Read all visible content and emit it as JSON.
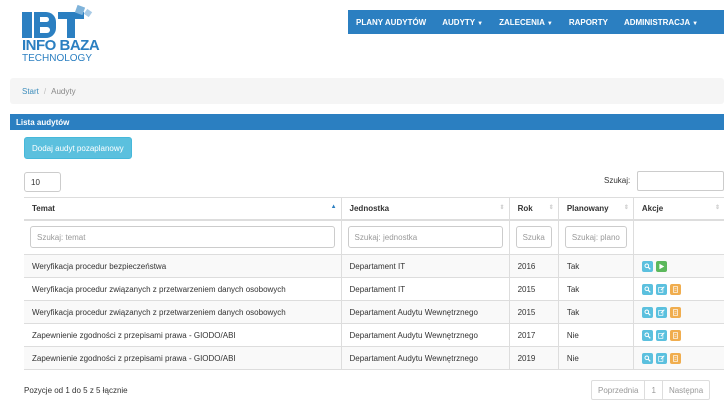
{
  "brand": {
    "line1": "INFO BAZA",
    "line2": "TECHNOLOGY"
  },
  "nav": [
    {
      "label": "PLANY AUDYTÓW",
      "dropdown": false
    },
    {
      "label": "AUDYTY",
      "dropdown": true
    },
    {
      "label": "ZALECENIA",
      "dropdown": true
    },
    {
      "label": "RAPORTY",
      "dropdown": false
    },
    {
      "label": "ADMINISTRACJA",
      "dropdown": true
    }
  ],
  "breadcrumb": {
    "home": "Start",
    "separator": "/",
    "current": "Audyty"
  },
  "panel": {
    "title": "Lista audytów",
    "add_button": "Dodaj audyt pozaplanowy"
  },
  "table_controls": {
    "page_length": "10",
    "search_label": "Szukaj:",
    "search_value": ""
  },
  "columns": [
    "Temat",
    "Jednostka",
    "Rok",
    "Planowany",
    "Akcje"
  ],
  "filters": {
    "temat": "Szukaj: temat",
    "jednostka": "Szukaj: jednostka",
    "rok": "Szuka",
    "planowany": "Szukaj: plano"
  },
  "rows": [
    {
      "temat": "Weryfikacja procedur bezpieczeństwa",
      "jednostka": "Departament IT",
      "rok": "2016",
      "planowany": "Tak",
      "actions": [
        "view-icon",
        "play-icon"
      ]
    },
    {
      "temat": "Weryfikacja procedur związanych z przetwarzeniem danych osobowych",
      "jednostka": "Departament IT",
      "rok": "2015",
      "planowany": "Tak",
      "actions": [
        "view-icon",
        "edit-icon",
        "document-icon"
      ]
    },
    {
      "temat": "Weryfikacja procedur związanych z przetwarzeniem danych osobowych",
      "jednostka": "Departament Audytu Wewnętrznego",
      "rok": "2015",
      "planowany": "Tak",
      "actions": [
        "view-icon",
        "edit-icon",
        "document-icon"
      ]
    },
    {
      "temat": "Zapewnienie zgodności z przepisami prawa - GIODO/ABI",
      "jednostka": "Departament Audytu Wewnętrznego",
      "rok": "2017",
      "planowany": "Nie",
      "actions": [
        "view-icon",
        "edit-icon",
        "document-icon"
      ]
    },
    {
      "temat": "Zapewnienie zgodności z przepisami prawa - GIODO/ABI",
      "jednostka": "Departament Audytu Wewnętrznego",
      "rok": "2019",
      "planowany": "Nie",
      "actions": [
        "view-icon",
        "edit-icon",
        "document-icon"
      ]
    }
  ],
  "footer": {
    "info": "Pozycje od 1 do 5 z 5 łącznie",
    "prev": "Poprzednia",
    "page": "1",
    "next": "Następna"
  },
  "colors": {
    "primary": "#2b7fc1",
    "info": "#5bc0de",
    "success": "#5cb85c",
    "warning": "#f0ad4e"
  }
}
